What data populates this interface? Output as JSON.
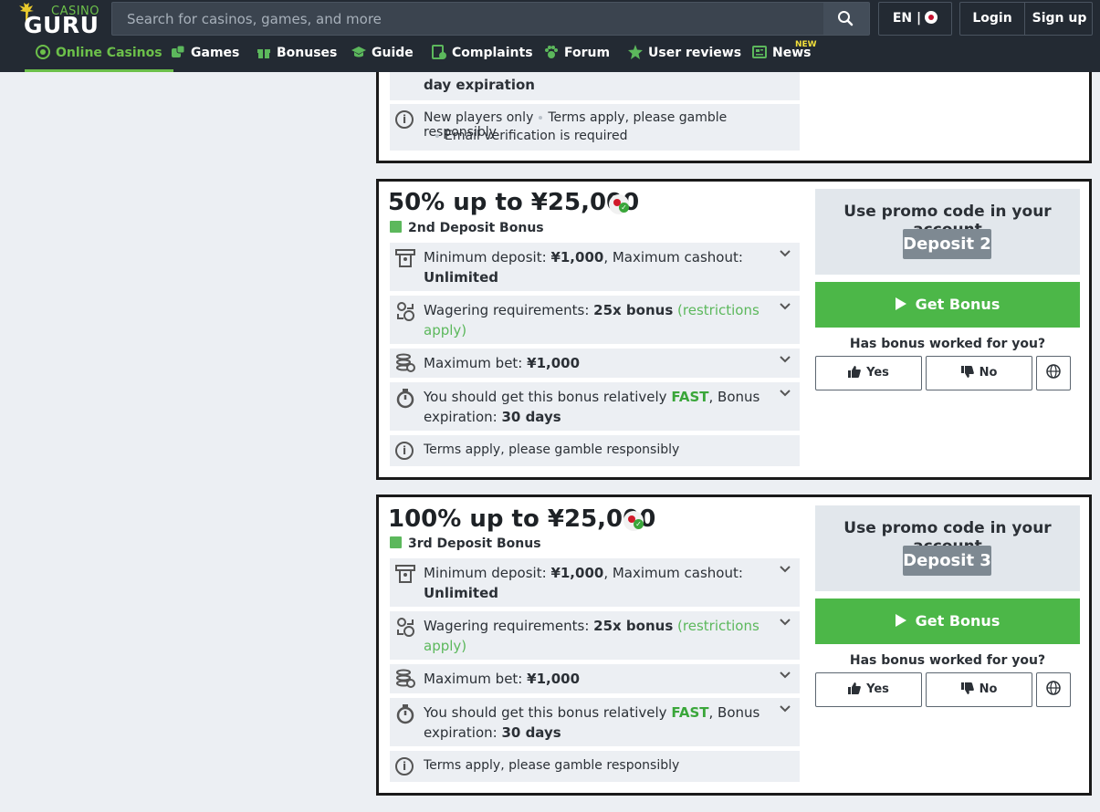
{
  "header": {
    "logo_small": "CASINO",
    "logo_big": "GURU",
    "search_placeholder": "Search for casinos, games, and more",
    "lang": "EN |",
    "login": "Login",
    "signup": "Sign up"
  },
  "nav": {
    "items": [
      {
        "label": "Online Casinos"
      },
      {
        "label": "Games"
      },
      {
        "label": "Bonuses"
      },
      {
        "label": "Guide"
      },
      {
        "label": "Complaints"
      },
      {
        "label": "Forum"
      },
      {
        "label": "User reviews"
      },
      {
        "label": "News"
      }
    ],
    "new_badge": "NEW"
  },
  "top_card": {
    "partial_line": "day expiration",
    "terms": [
      "New players only",
      "Terms apply, please gamble responsibly",
      "Email verification is required"
    ]
  },
  "bonuses": [
    {
      "title": "50% up to ¥25,000",
      "type": "2nd Deposit Bonus",
      "min_deposit_label": "Minimum deposit:",
      "min_deposit": "¥1,000",
      "max_cashout_label": ", Maximum cashout:",
      "max_cashout": "Unlimited",
      "wagering_label": "Wagering requirements:",
      "wagering": "25x bonus",
      "restrictions": "(restrictions apply)",
      "max_bet_label": "Maximum bet:",
      "max_bet": "¥1,000",
      "speed_label": "You should get this bonus relatively",
      "speed": "FAST",
      "expiration_label": ", Bonus expiration:",
      "expiration": "30 days",
      "terms": "Terms apply, please gamble responsibly",
      "promo_text": "Use promo code in your account",
      "promo_code": "Deposit 2",
      "get_bonus": "Get Bonus",
      "worked": "Has bonus worked for you?",
      "yes": "Yes",
      "no": "No"
    },
    {
      "title": "100% up to ¥25,000",
      "type": "3rd Deposit Bonus",
      "min_deposit_label": "Minimum deposit:",
      "min_deposit": "¥1,000",
      "max_cashout_label": ", Maximum cashout:",
      "max_cashout": "Unlimited",
      "wagering_label": "Wagering requirements:",
      "wagering": "25x bonus",
      "restrictions": "(restrictions apply)",
      "max_bet_label": "Maximum bet:",
      "max_bet": "¥1,000",
      "speed_label": "You should get this bonus relatively",
      "speed": "FAST",
      "expiration_label": ", Bonus expiration:",
      "expiration": "30 days",
      "terms": "Terms apply, please gamble responsibly",
      "promo_text": "Use promo code in your account",
      "promo_code": "Deposit 3",
      "get_bonus": "Get Bonus",
      "worked": "Has bonus worked for you?",
      "yes": "Yes",
      "no": "No"
    }
  ],
  "colors": {
    "header_bg": "#232a33",
    "accent_green": "#4cb748",
    "page_bg": "#eceff3"
  }
}
